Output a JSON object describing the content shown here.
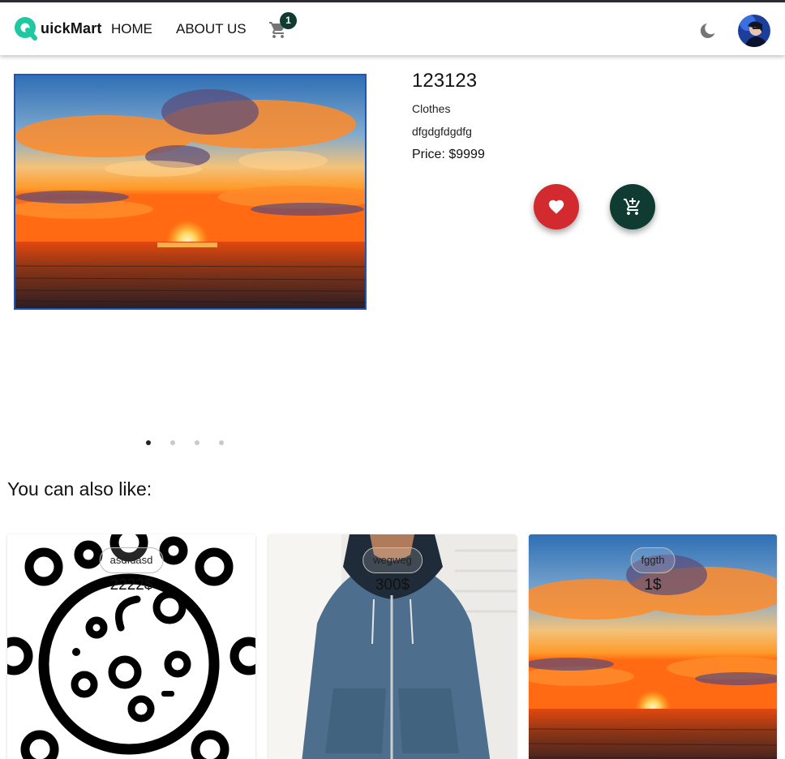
{
  "header": {
    "logo_text": "uickMart",
    "nav": {
      "home": "HOME",
      "about": "ABOUT US"
    },
    "cart_count": "1"
  },
  "product": {
    "title": "123123",
    "category": "Clothes",
    "description": "dfgdgfdgdfg",
    "price": "Price: $9999"
  },
  "carousel": {
    "slides": 4,
    "active_index": 0
  },
  "recommendations": {
    "heading": "You can also like:",
    "items": [
      {
        "name": "asdfdasd",
        "price": "2222$",
        "image": "virus-icon"
      },
      {
        "name": "wegweg",
        "price": "300$",
        "image": "hoodie-photo"
      },
      {
        "name": "fggth",
        "price": "1$",
        "image": "sunset-photo"
      }
    ]
  },
  "colors": {
    "brand_teal": "#1ec9a2",
    "dark_green": "#0f3b33",
    "favorite_red": "#d32a2f",
    "image_border": "#1b56b8"
  },
  "icons": [
    "shopping-cart-icon",
    "moon-icon",
    "heart-icon",
    "add-to-cart-icon"
  ]
}
